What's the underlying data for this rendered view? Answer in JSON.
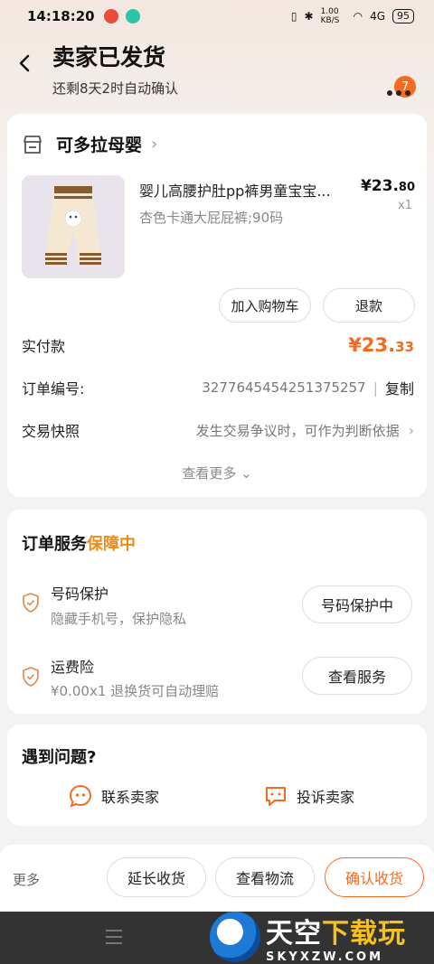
{
  "status_bar": {
    "time": "14:18:20",
    "speed": "1.00 KB/S",
    "network": "4G",
    "battery": "95"
  },
  "header": {
    "title": "卖家已发货",
    "subtitle": "还剩8天2时自动确认",
    "message_badge": "7"
  },
  "order": {
    "shop_name": "可多拉母婴",
    "product": {
      "title": "婴儿高腰护肚pp裤男童宝宝...",
      "sku": "杏色卡通大屁屁裤;90码",
      "price_int": "¥23.",
      "price_dec": "80",
      "quantity": "x1"
    },
    "buttons": {
      "add_to_cart": "加入购物车",
      "refund": "退款"
    },
    "paid": {
      "label": "实付款",
      "amount_int": "¥23.",
      "amount_dec": "33"
    },
    "order_no": {
      "label": "订单编号:",
      "value": "3277645454251375257",
      "separator": "|",
      "copy": "复制"
    },
    "snapshot": {
      "label": "交易快照",
      "hint": "发生交易争议时，可作为判断依据"
    },
    "see_more": "查看更多"
  },
  "service": {
    "title_prefix": "订单服务",
    "title_highlight": "保障中",
    "items": [
      {
        "name": "号码保护",
        "desc": "隐藏手机号，保护隐私",
        "button": "号码保护中"
      },
      {
        "name": "运费险",
        "desc": "¥0.00x1  退换货可自动理赔",
        "button": "查看服务"
      }
    ]
  },
  "help": {
    "title": "遇到问题?",
    "contact_seller": "联系卖家",
    "complain_seller": "投诉卖家"
  },
  "bottom_bar": {
    "more": "更多",
    "extend": "延长收货",
    "logistics": "查看物流",
    "confirm": "确认收货"
  },
  "watermark": {
    "brand_a": "天空",
    "brand_b": "下载玩",
    "url": "SKYXZW.COM"
  },
  "colors": {
    "accent": "#f46b1e",
    "highlight": "#f08a17"
  }
}
